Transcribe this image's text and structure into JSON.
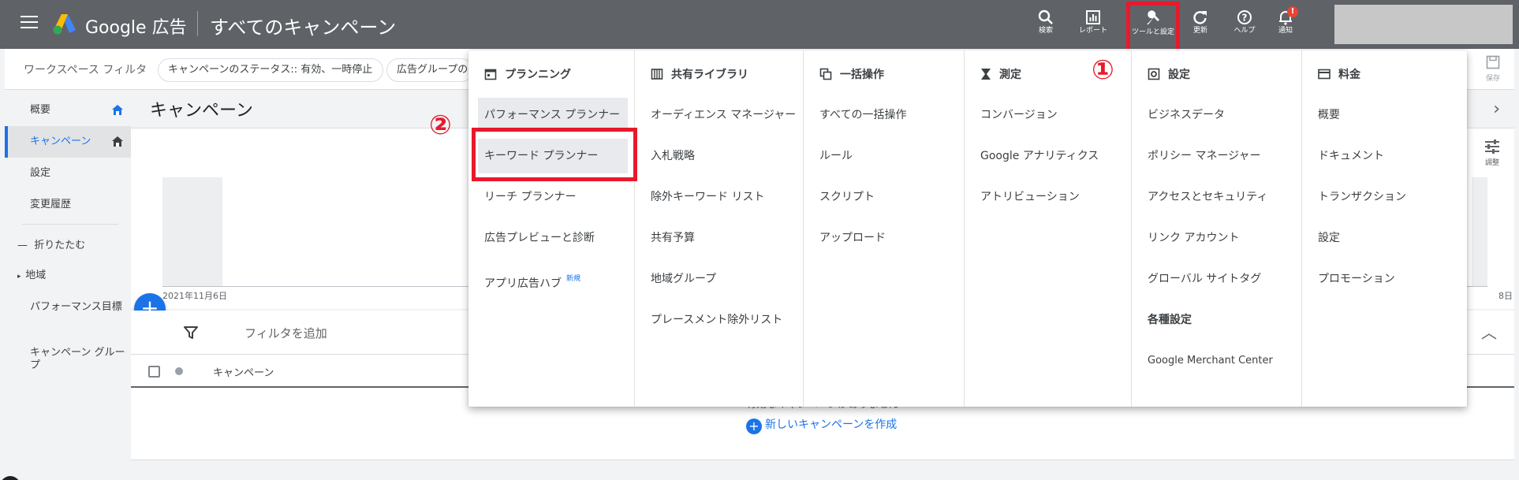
{
  "header": {
    "brand": "Google 広告",
    "page_title": "すべてのキャンペーン",
    "buttons": [
      {
        "icon": "search-icon",
        "label": "検索"
      },
      {
        "icon": "report-icon",
        "label": "レポート"
      },
      {
        "icon": "wrench-icon",
        "label": "ツールと設定"
      },
      {
        "icon": "refresh-icon",
        "label": "更新"
      },
      {
        "icon": "help-icon",
        "label": "ヘルプ"
      },
      {
        "icon": "bell-icon",
        "label": "通知",
        "badge": "!"
      }
    ]
  },
  "filterbar": {
    "workspace_label": "ワークスペース フィルタ",
    "chips": [
      "キャンペーンのステータス:: 有効、一時停止",
      "広告グループのステータス"
    ],
    "save_label": "保存"
  },
  "leftnav": {
    "items": [
      "概要",
      "キャンペーン",
      "設定",
      "変更履歴"
    ],
    "collapse": "折りたたむ",
    "sub": [
      "地域",
      "パフォーマンス目標",
      "キャンペーン グループ"
    ]
  },
  "main": {
    "title": "キャンペーン",
    "date_start": "2021年11月6日",
    "date_end": "8日",
    "adjust_label": "調整",
    "filter_add": "フィルタを追加",
    "col_campaign": "キャンペーン",
    "empty_text": "有効なキャンペーンがありません",
    "new_campaign": "新しいキャンペーンを作成"
  },
  "dropdown": {
    "columns": [
      {
        "icon": "calendar-icon",
        "heading": "プランニング",
        "items": [
          "パフォーマンス プランナー",
          "キーワード プランナー",
          "リーチ プランナー",
          "広告プレビューと診断",
          "アプリ広告ハブ"
        ],
        "badge": "新規"
      },
      {
        "icon": "library-icon",
        "heading": "共有ライブラリ",
        "items": [
          "オーディエンス マネージャー",
          "入札戦略",
          "除外キーワード リスト",
          "共有予算",
          "地域グループ",
          "プレースメント除外リスト"
        ]
      },
      {
        "icon": "bulk-icon",
        "heading": "一括操作",
        "items": [
          "すべての一括操作",
          "ルール",
          "スクリプト",
          "アップロード"
        ]
      },
      {
        "icon": "hourglass-icon",
        "heading": "測定",
        "items": [
          "コンバージョン",
          "Google アナリティクス",
          "アトリビューション"
        ]
      },
      {
        "icon": "settings-icon",
        "heading": "設定",
        "items": [
          "ビジネスデータ",
          "ポリシー マネージャー",
          "アクセスとセキュリティ",
          "リンク アカウント",
          "グローバル サイトタグ",
          "各種設定",
          "Google Merchant Center"
        ]
      },
      {
        "icon": "billing-icon",
        "heading": "料金",
        "items": [
          "概要",
          "ドキュメント",
          "トランザクション",
          "設定",
          "プロモーション"
        ]
      }
    ]
  },
  "annotations": {
    "step1": "①",
    "step2": "②"
  },
  "colors": {
    "header": "#5f6368",
    "accent": "#1a73e8",
    "highlight": "#e8192c"
  }
}
